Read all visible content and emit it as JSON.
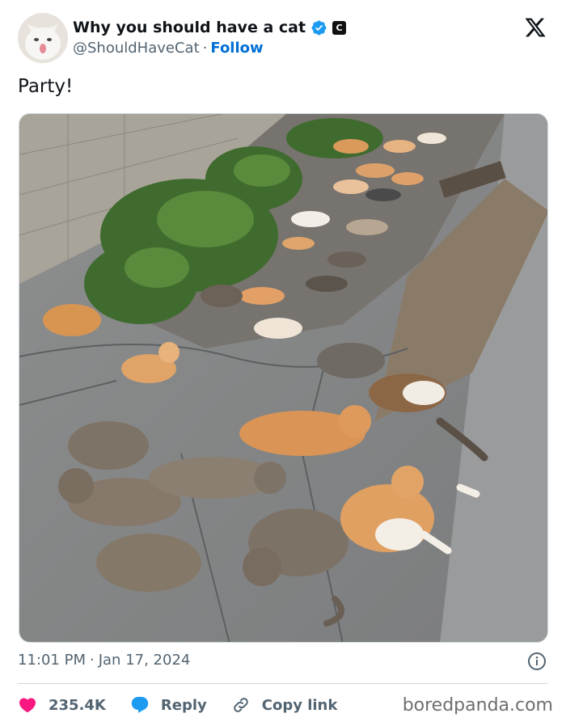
{
  "tweet": {
    "display_name": "Why you should have a cat",
    "handle": "@ShouldHaveCat",
    "separator": "·",
    "follow_label": "Follow",
    "text": "Party!",
    "time": "11:01 PM",
    "date": "Jan 17, 2024",
    "avatar_icon": "white-cat-avatar",
    "verified_icon": "verified-badge-icon",
    "affiliate_badge": "C",
    "brand_icon": "x-logo-icon"
  },
  "media": {
    "description_icon": "photo-cats-lying-on-pavement"
  },
  "actions": {
    "likes_count": "235.4K",
    "reply_label": "Reply",
    "copy_link_label": "Copy link"
  },
  "watermark": "boredpanda.com",
  "colors": {
    "accent": "#1d9bf0",
    "follow": "#006fd6",
    "like": "#f91880",
    "muted": "#536471",
    "text": "#0f1419"
  }
}
